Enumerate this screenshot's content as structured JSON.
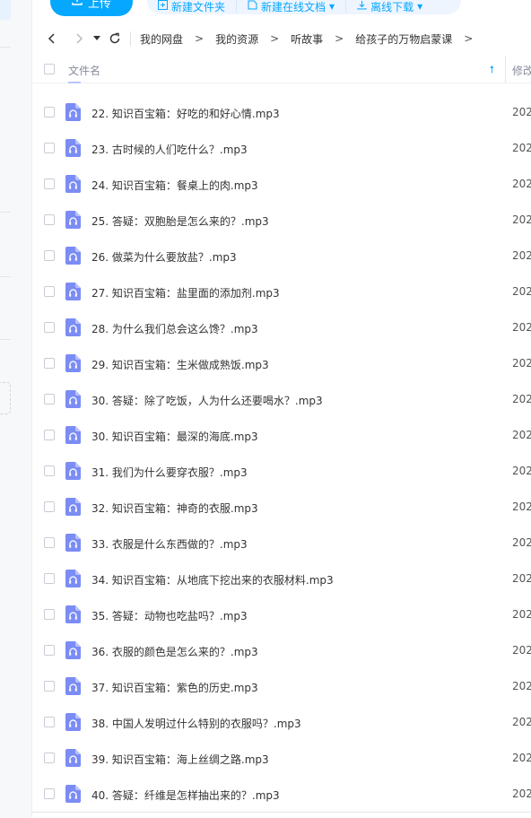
{
  "toolbar": {
    "upload_label": "上传",
    "new_folder_label": "新建文件夹",
    "new_doc_label": "新建在线文档",
    "offline_download_label": "离线下载"
  },
  "breadcrumb": [
    "我的网盘",
    "我的资源",
    "听故事",
    "给孩子的万物启蒙课"
  ],
  "table": {
    "col_name": "文件名",
    "col_modified": "修改",
    "rows": [
      {
        "name": "22. 知识百宝箱：好吃的和好心情.mp3",
        "date": "202"
      },
      {
        "name": "23. 古时候的人们吃什么？.mp3",
        "date": "202"
      },
      {
        "name": "24. 知识百宝箱：餐桌上的肉.mp3",
        "date": "202"
      },
      {
        "name": "25. 答疑：双胞胎是怎么来的？.mp3",
        "date": "202"
      },
      {
        "name": "26. 做菜为什么要放盐？.mp3",
        "date": "202"
      },
      {
        "name": "27. 知识百宝箱：盐里面的添加剂.mp3",
        "date": "202"
      },
      {
        "name": "28. 为什么我们总会这么馋？.mp3",
        "date": "202"
      },
      {
        "name": "29. 知识百宝箱：生米做成熟饭.mp3",
        "date": "202"
      },
      {
        "name": "30. 答疑：除了吃饭，人为什么还要喝水？.mp3",
        "date": "202"
      },
      {
        "name": "30. 知识百宝箱：最深的海底.mp3",
        "date": "202"
      },
      {
        "name": "31. 我们为什么要穿衣服？.mp3",
        "date": "202"
      },
      {
        "name": "32. 知识百宝箱：神奇的衣服.mp3",
        "date": "202"
      },
      {
        "name": "33. 衣服是什么东西做的？.mp3",
        "date": "202"
      },
      {
        "name": "34. 知识百宝箱：从地底下挖出来的衣服材料.mp3",
        "date": "202"
      },
      {
        "name": "35. 答疑：动物也吃盐吗？.mp3",
        "date": "202"
      },
      {
        "name": "36. 衣服的颜色是怎么来的？.mp3",
        "date": "202"
      },
      {
        "name": "37. 知识百宝箱：紫色的历史.mp3",
        "date": "202"
      },
      {
        "name": "38. 中国人发明过什么特别的衣服吗？.mp3",
        "date": "202"
      },
      {
        "name": "39. 知识百宝箱：海上丝绸之路.mp3",
        "date": "202"
      },
      {
        "name": "40. 答疑：纤维是怎样抽出来的？.mp3",
        "date": "202"
      }
    ]
  },
  "icons": {
    "back": "chevron-left-icon",
    "forward": "chevron-right-icon",
    "history": "chevron-down-icon",
    "refresh": "refresh-icon",
    "file": "audio-file-icon",
    "sort": "sort-ascending-icon"
  },
  "colors": {
    "accent": "#06a7ff",
    "audio_icon": "#7b8cf5"
  }
}
